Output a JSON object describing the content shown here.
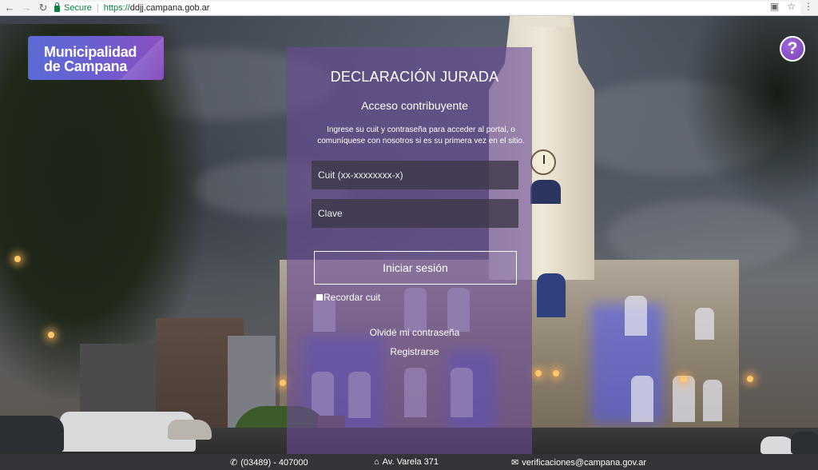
{
  "browser": {
    "security_label": "Secure",
    "url_protocol": "https://",
    "url_host": "ddjj.campana.gob.ar",
    "icons": [
      "back-icon",
      "forward-icon",
      "reload-icon",
      "lock-icon",
      "translate-icon",
      "star-icon",
      "menu-icon"
    ]
  },
  "logo": {
    "line1": "Municipalidad",
    "line2": "de Campana"
  },
  "help": {
    "symbol": "?"
  },
  "panel": {
    "title": "DECLARACIÓN JURADA",
    "subtitle": "Acceso contribuyente",
    "description_line1": "Ingrese su cuit y contraseña para acceder al portal, o",
    "description_line2": "comuníquese con nosotros si es su primera vez en el sitio.",
    "cuit_placeholder": "Cuit (xx-xxxxxxxx-x)",
    "clave_placeholder": "Clave",
    "login_label": "Iniciar sesión",
    "remember_label": "Recordar cuit",
    "forgot_label": "Olvidé mi contraseña",
    "register_label": "Registrarse"
  },
  "footer": {
    "phone": "(03489) - 407000",
    "address": "Av. Varela 371",
    "email": "verificaciones@campana.gov.ar"
  },
  "colors": {
    "panel_bg": "#694b96",
    "logo_start": "#5b6bd6",
    "logo_end": "#8b4fbf",
    "help_bg": "#7a3fb8",
    "footer_bg": "#333438"
  }
}
